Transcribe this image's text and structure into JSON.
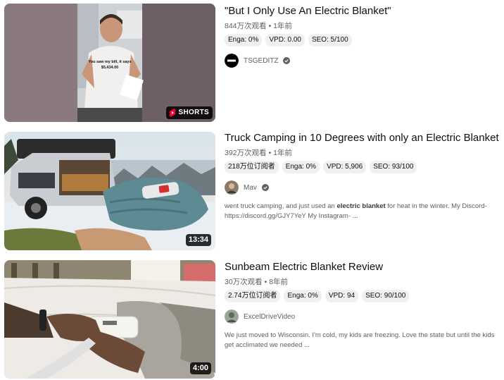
{
  "results": [
    {
      "title": "\"But I Only Use An Electric Blanket\"",
      "views": "844万次观看",
      "sep": "•",
      "age": "1年前",
      "chips": [
        "Enga: 0%",
        "VPD: 0.00",
        "SEO: 5/100"
      ],
      "channel": "TSGEDITZ",
      "verified": true,
      "badge": "SHORTS",
      "thumb_caption": "You saw my bill, it says $5,434.00",
      "description": ""
    },
    {
      "title": "Truck Camping in 10 Degrees with only an Electric Blanket",
      "views": "392万次观看",
      "sep": "•",
      "age": "1年前",
      "chips": [
        "218万位订阅者",
        "Enga: 0%",
        "VPD: 5,906",
        "SEO: 93/100"
      ],
      "channel": "Mav",
      "verified": true,
      "duration": "13:34",
      "description_pre": "went truck camping, and just used an ",
      "description_bold": "electric blanket",
      "description_post": " for heat in the winter. My Discord- https://discord.gg/GJY7YeY My Instagram- ..."
    },
    {
      "title": "Sunbeam Electric Blanket Review",
      "views": "30万次观看",
      "sep": "•",
      "age": "8年前",
      "chips": [
        "2.74万位订阅者",
        "Enga: 0%",
        "VPD: 94",
        "SEO: 90/100"
      ],
      "channel": "ExcelDriveVideo",
      "verified": false,
      "duration": "4:00",
      "description": "We just moved to Wisconsin. I'm cold, my kids are freezing. Love the state but until the kids get acclimated we needed ..."
    }
  ],
  "colors": {
    "shorts_red": "#ff0033",
    "meta_gray": "#606060",
    "chip_bg": "#f0f0f0"
  }
}
